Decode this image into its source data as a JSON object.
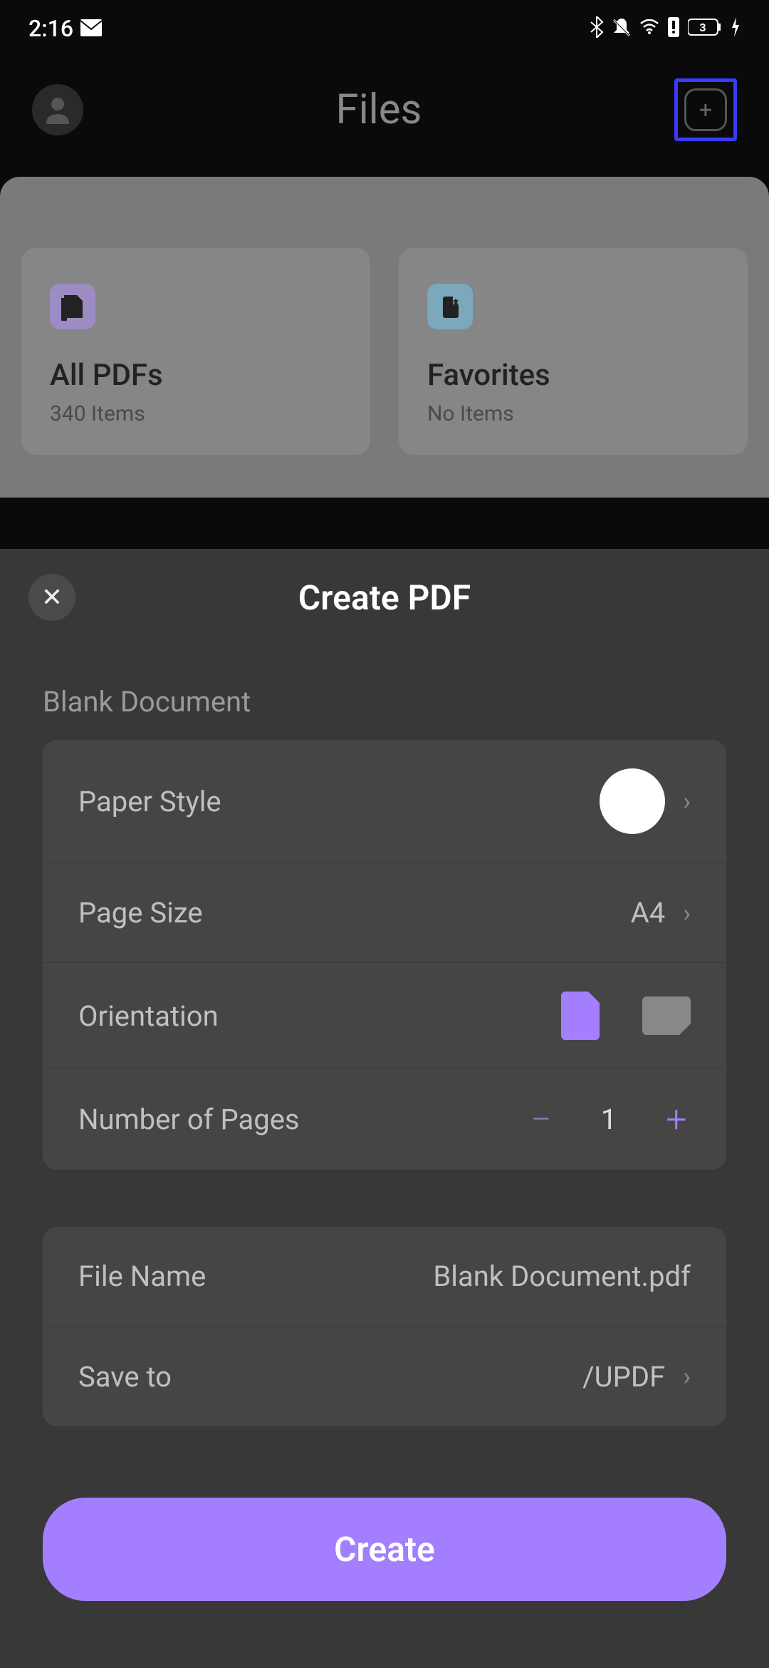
{
  "status": {
    "time": "2:16",
    "battery": "3"
  },
  "header": {
    "title": "Files"
  },
  "folders": [
    {
      "title": "All PDFs",
      "subtitle": "340 Items"
    },
    {
      "title": "Favorites",
      "subtitle": "No Items"
    }
  ],
  "modal": {
    "title": "Create PDF",
    "section_label": "Blank Document",
    "settings": {
      "paper_style_label": "Paper Style",
      "page_size_label": "Page Size",
      "page_size_value": "A4",
      "orientation_label": "Orientation",
      "pages_label": "Number of Pages",
      "pages_value": "1",
      "file_name_label": "File Name",
      "file_name_value": "Blank Document.pdf",
      "save_to_label": "Save to",
      "save_to_value": "/UPDF"
    },
    "create_label": "Create"
  }
}
